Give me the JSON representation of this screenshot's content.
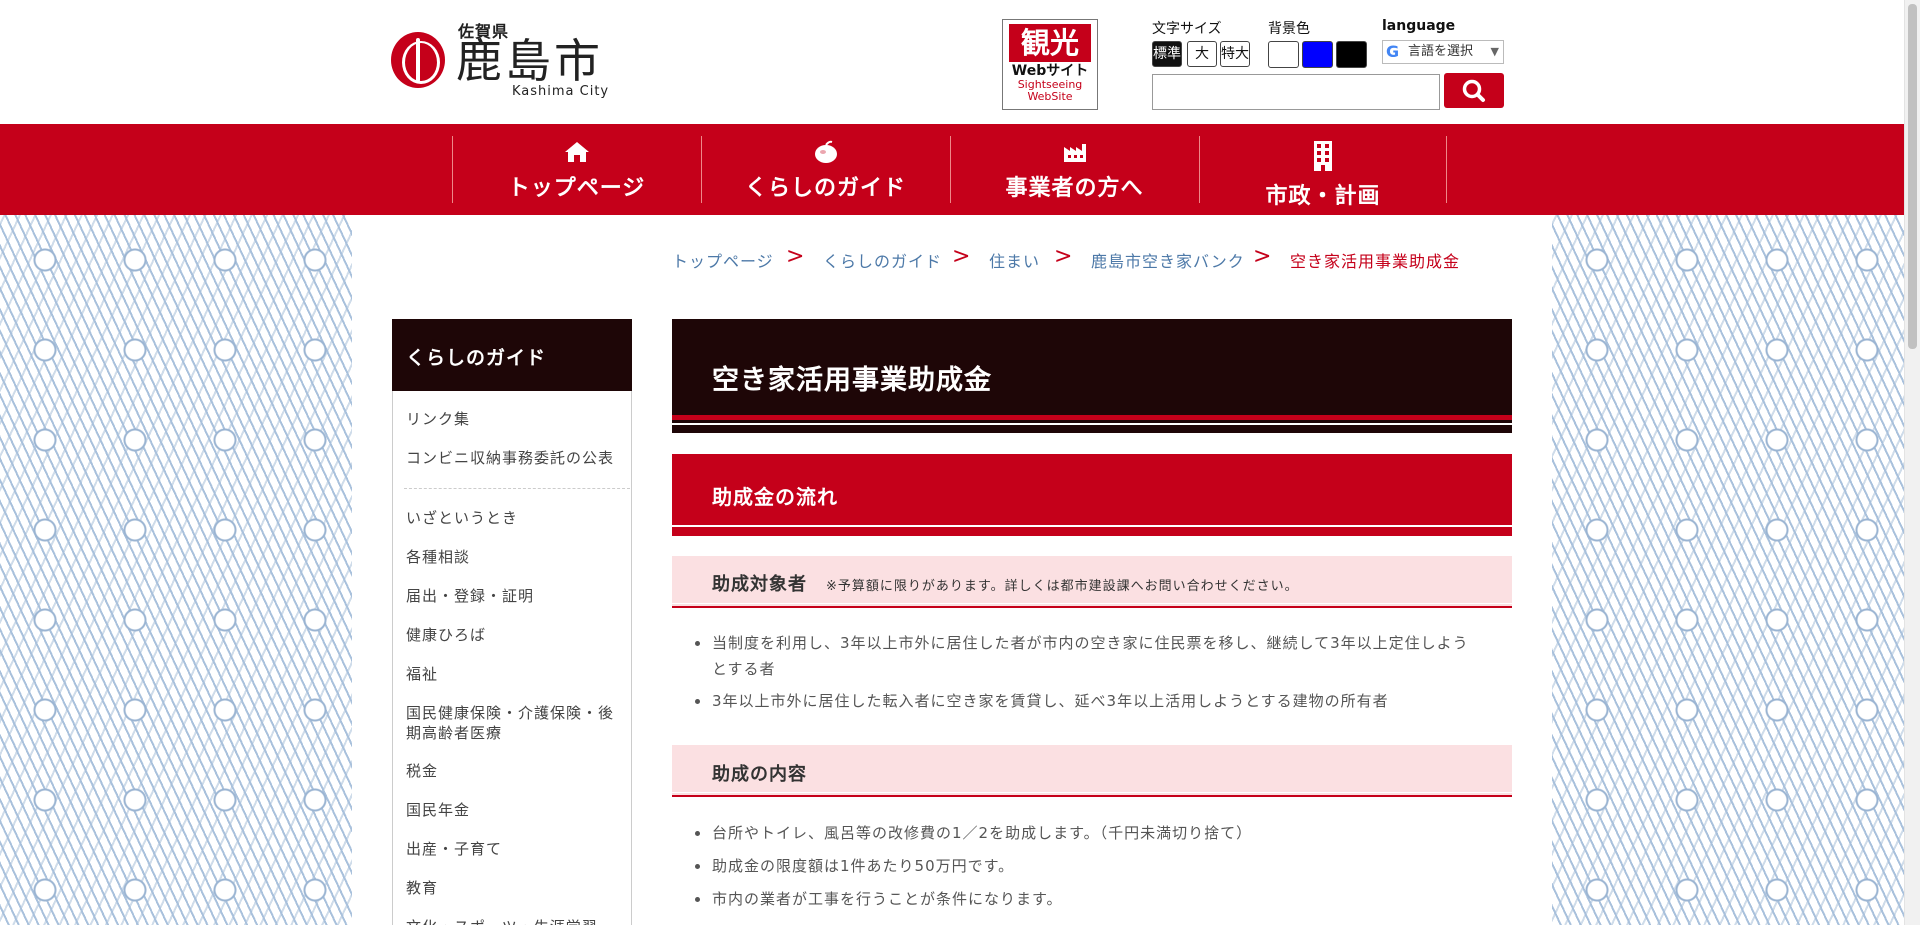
{
  "header": {
    "prefecture": "佐賀県",
    "city": "鹿島市",
    "city_en": "Kashima City",
    "kanko": {
      "title": "観光",
      "web": "Webサイト",
      "sub1": "Sightseeing",
      "sub2": "WebSite"
    },
    "font_size_label": "文字サイズ",
    "font_sizes": [
      "標準",
      "大",
      "特大"
    ],
    "bg_label": "背景色",
    "bg_colors": [
      "#ffffff",
      "#0000ff",
      "#000000"
    ],
    "language_label": "language",
    "language_select": "言語を選択",
    "search_placeholder": ""
  },
  "nav": [
    {
      "label": "トップページ",
      "icon": "home-icon"
    },
    {
      "label": "くらしのガイド",
      "icon": "apple-icon"
    },
    {
      "label": "事業者の方へ",
      "icon": "factory-icon"
    },
    {
      "label": "市政・計画",
      "icon": "building-icon"
    }
  ],
  "breadcrumb": [
    "トップページ",
    "くらしのガイド",
    "住まい",
    "鹿島市空き家バンク",
    "空き家活用事業助成金"
  ],
  "sidebar": {
    "title": "くらしのガイド",
    "top_items": [
      "リンク集",
      "コンビニ収納事務委託の公表"
    ],
    "items": [
      "いざというとき",
      "各種相談",
      "届出・登録・証明",
      "健康ひろば",
      "福祉",
      "国民健康保険・介護保険・後期高齢者医療",
      "税金",
      "国民年金",
      "出産・子育て",
      "教育",
      "文化・スポーツ・生涯学習"
    ]
  },
  "main": {
    "title": "空き家活用事業助成金",
    "section_title": "助成金の流れ",
    "subsections": [
      {
        "title": "助成対象者",
        "note": "※予算額に限りがあります。詳しくは都市建設課へお問い合わせください。",
        "items": [
          "当制度を利用し、3年以上市外に居住した者が市内の空き家に住民票を移し、継続して3年以上定住しようとする者",
          "3年以上市外に居住した転入者に空き家を賃貸し、延べ3年以上活用しようとする建物の所有者"
        ]
      },
      {
        "title": "助成の内容",
        "note": "",
        "items": [
          "台所やトイレ、風呂等の改修費の1／2を助成します。（千円未満切り捨て）",
          "助成金の限度額は1件あたり50万円です。",
          "市内の業者が工事を行うことが条件になります。"
        ]
      }
    ]
  },
  "colors": {
    "accent": "#c5001a",
    "dark": "#1e0607",
    "pink": "#fbe0e2",
    "link": "#4d79a8"
  }
}
